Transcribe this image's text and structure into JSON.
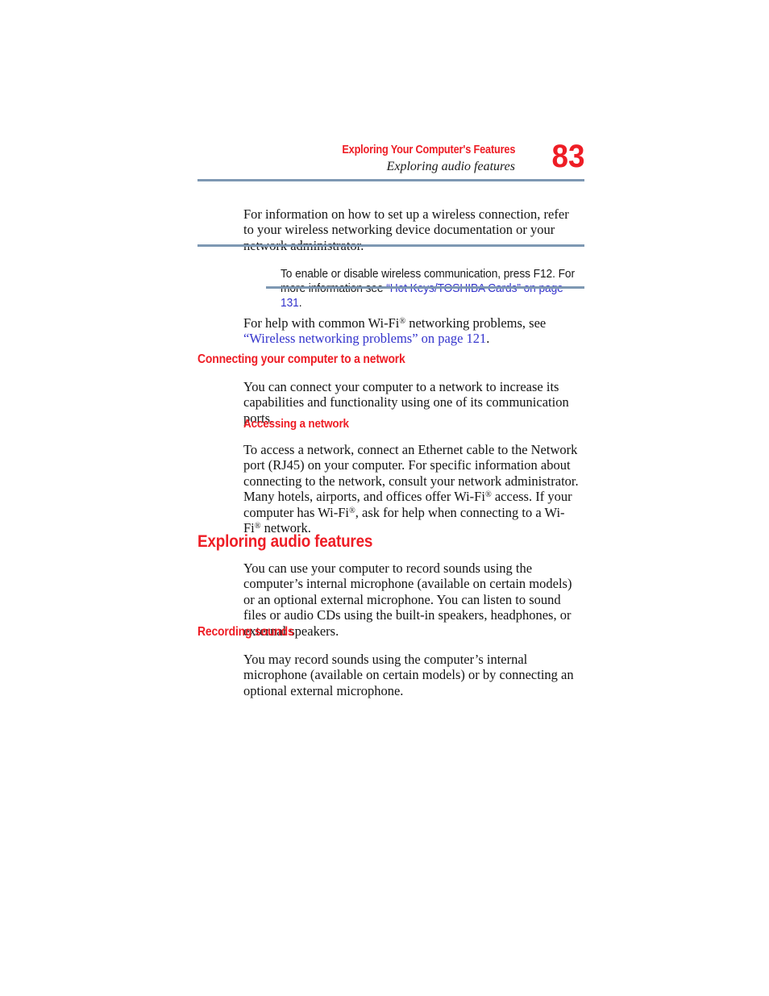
{
  "header": {
    "chapter_title": "Exploring Your Computer's Features",
    "section_subtitle": "Exploring audio features",
    "page_number": "83"
  },
  "colors": {
    "heading_red": "#ee1d25",
    "rule_blue_gray": "#7e98b3",
    "link_blue": "#3333cc",
    "body_text": "#141414"
  },
  "content": {
    "wireless_paragraph": "For information on how to set up a wireless connection, refer to your wireless networking device documentation or your network administrator.",
    "note": {
      "text_before_link": "To enable or disable wireless communication, press F12. For more information see ",
      "link_text": "“Hot Keys/TOSHIBA Cards” on page 131",
      "text_after_link": "."
    },
    "wifi_help": {
      "text_before_link": "For help with common Wi-Fi",
      "superscript": "®",
      "text_middle": " networking problems, see ",
      "link_text": "“Wireless networking problems” on page 121",
      "text_after_link": "."
    },
    "heading_connecting": "Connecting your computer to a network",
    "paragraph_connecting": "You can connect your computer to a network to increase its capabilities and functionality using one of its communication ports.",
    "heading_accessing": "Accessing a network",
    "paragraph_accessing": {
      "part1": "To access a network, connect an Ethernet cable to the Network port (RJ45) on your computer. For specific information about connecting to the network, consult your network administrator. Many hotels, airports, and offices offer Wi-Fi",
      "sup1": "®",
      "part2": " access. If your computer has Wi-Fi",
      "sup2": "®",
      "part3": ", ask for help when connecting to a Wi-Fi",
      "sup3": "®",
      "part4": " network."
    },
    "heading_audio": "Exploring audio features",
    "paragraph_audio": "You can use your computer to record sounds using the computer’s internal microphone (available on certain models) or an optional external microphone. You can listen to sound files or audio CDs using the built-in speakers, headphones, or external speakers.",
    "heading_recording": "Recording sounds",
    "paragraph_recording": "You may record sounds using the computer’s internal microphone (available on certain models) or by connecting an optional external microphone."
  }
}
